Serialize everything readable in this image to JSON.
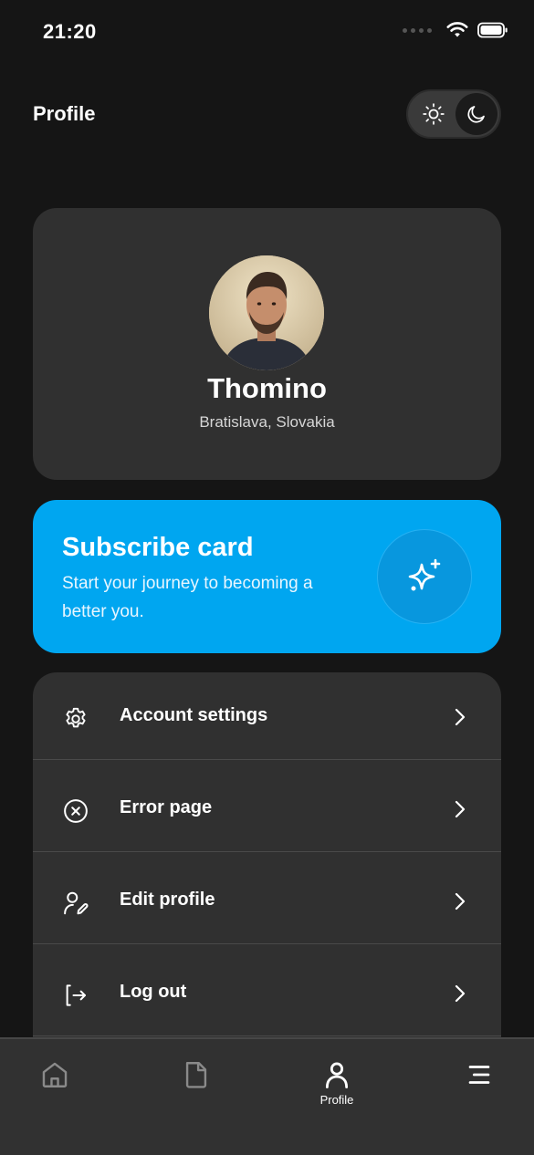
{
  "status_bar": {
    "time": "21:20"
  },
  "header": {
    "title": "Profile"
  },
  "theme_toggle": {
    "options": [
      "light",
      "dark"
    ],
    "selected": "dark"
  },
  "profile": {
    "name": "Thomino",
    "location": "Bratislava, Slovakia"
  },
  "subscribe": {
    "title": "Subscribe card",
    "text": "Start your journey to becoming a better you.",
    "icon": "sparkles-icon",
    "color": "#00a6f0"
  },
  "menu": {
    "items": [
      {
        "label": "Account settings",
        "icon": "gear-icon"
      },
      {
        "label": "Error page",
        "icon": "x-circle-icon"
      },
      {
        "label": "Edit profile",
        "icon": "user-edit-icon"
      },
      {
        "label": "Log out",
        "icon": "logout-icon"
      }
    ]
  },
  "bottom_nav": {
    "items": [
      {
        "id": "home",
        "icon": "home-icon",
        "label": ""
      },
      {
        "id": "documents",
        "icon": "document-icon",
        "label": ""
      },
      {
        "id": "profile",
        "icon": "user-icon",
        "label": "Profile"
      },
      {
        "id": "menu",
        "icon": "menu-lines-icon",
        "label": ""
      }
    ],
    "active": "profile"
  },
  "colors": {
    "background": "#151515",
    "card": "#303030",
    "accent": "#00a6f0",
    "nav": "#313131"
  }
}
